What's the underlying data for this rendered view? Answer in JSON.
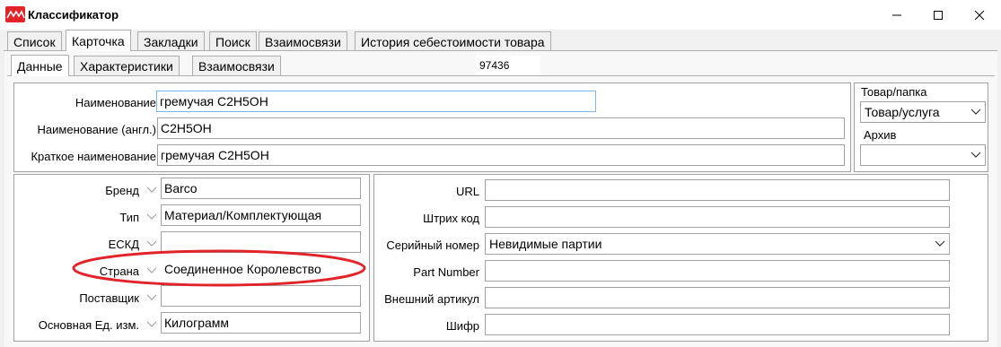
{
  "window": {
    "title": "Классификатор"
  },
  "main_tabs": [
    {
      "label": "Список"
    },
    {
      "label": "Карточка"
    },
    {
      "label": "Закладки"
    },
    {
      "label": "Поиск"
    },
    {
      "label": "Взаимосвязи"
    },
    {
      "label": "История себестоимости товара"
    }
  ],
  "sub_tabs": [
    {
      "label": "Данные"
    },
    {
      "label": "Характеристики"
    },
    {
      "label": "Взаимосвязи"
    }
  ],
  "record_id": "97436",
  "names": {
    "name_label": "Наименование",
    "name_value": "гремучая С2H5OH",
    "name_en_label": "Наименование (англ.)",
    "name_en_value": "C2H5OH",
    "short_name_label": "Краткое наименование",
    "short_name_value": "гремучая С2H5OH"
  },
  "side": {
    "type_label": "Товар/папка",
    "type_value": "Товар/услуга",
    "archive_label": "Архив",
    "archive_value": ""
  },
  "left_fields": [
    {
      "label": "Бренд",
      "value": "Barco"
    },
    {
      "label": "Тип",
      "value": "Материал/Комплектующая"
    },
    {
      "label": "ЕСКД",
      "value": ""
    },
    {
      "label": "Страна",
      "value": "Соединенное Королевство"
    },
    {
      "label": "Поставщик",
      "value": ""
    },
    {
      "label": "Основная Ед. изм.",
      "value": "Килограмм"
    }
  ],
  "right_fields": [
    {
      "label": "URL",
      "value": ""
    },
    {
      "label": "Штрих код",
      "value": ""
    },
    {
      "label": "Серийный номер",
      "value": "Невидимые партии"
    },
    {
      "label": "Part Number",
      "value": ""
    },
    {
      "label": "Внешний артикул",
      "value": ""
    },
    {
      "label": "Шифр",
      "value": ""
    }
  ],
  "colors": {
    "highlight_ellipse": "#e0242a",
    "focus_border": "#7eb4ea"
  }
}
